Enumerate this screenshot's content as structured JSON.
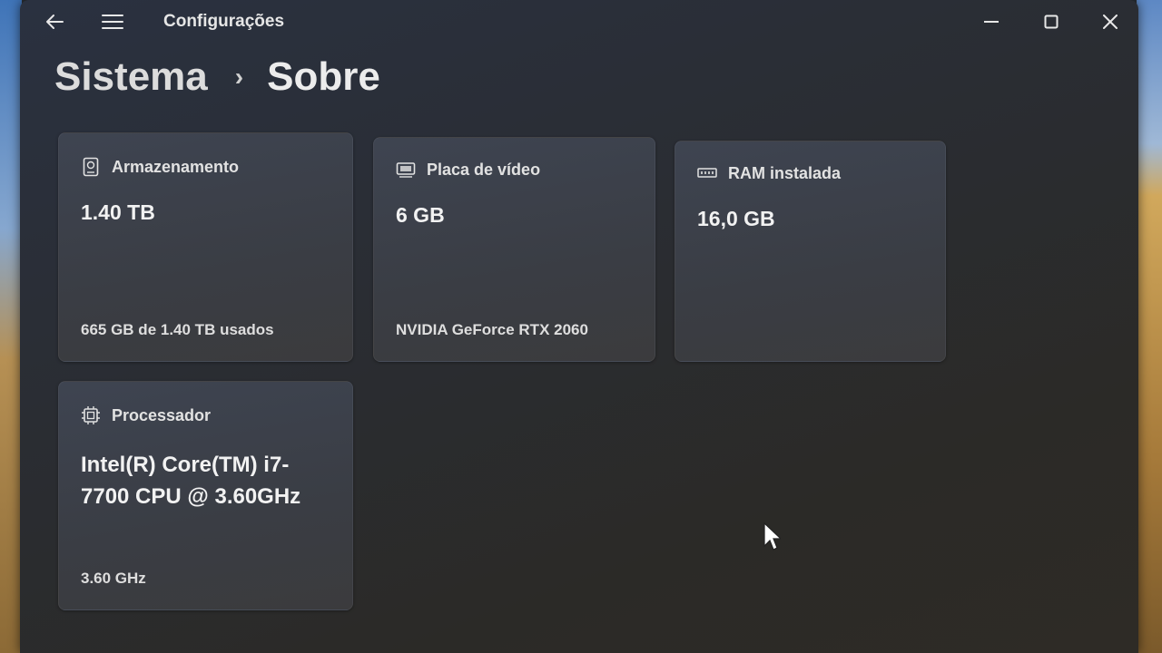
{
  "window": {
    "title": "Configurações",
    "back_icon": "back-arrow-icon",
    "menu_icon": "hamburger-menu-icon",
    "minimize_icon": "minimize-icon",
    "maximize_icon": "maximize-icon",
    "close_icon": "close-icon"
  },
  "breadcrumb": {
    "parent": "Sistema",
    "separator": "›",
    "current": "Sobre"
  },
  "cards": {
    "storage": {
      "icon": "hard-drive-icon",
      "label": "Armazenamento",
      "value": "1.40 TB",
      "detail": "665 GB de 1.40 TB usados"
    },
    "gpu": {
      "icon": "display-adapter-icon",
      "label": "Placa de vídeo",
      "value": "6 GB",
      "detail": "NVIDIA GeForce RTX 2060"
    },
    "ram": {
      "icon": "memory-icon",
      "label": "RAM instalada",
      "value": "16,0 GB"
    },
    "cpu": {
      "icon": "processor-icon",
      "label": "Processador",
      "value": "Intel(R) Core(TM) i7-7700 CPU @ 3.60GHz",
      "detail": "3.60 GHz"
    }
  },
  "colors": {
    "window_bg": "#2b2d31",
    "card_bg": "#3c3f46",
    "text": "#f0f0f0"
  }
}
